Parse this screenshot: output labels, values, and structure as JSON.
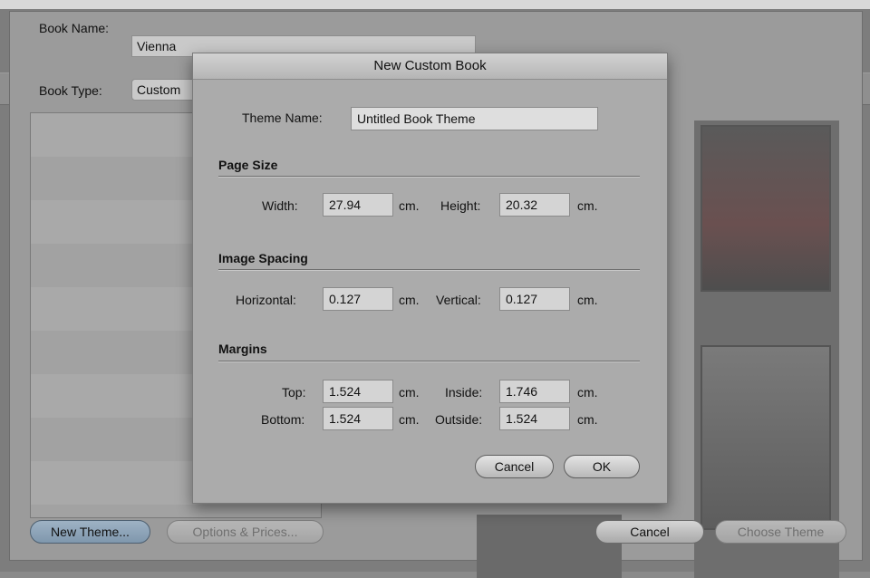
{
  "sheet": {
    "book_name_label": "Book Name:",
    "book_name_value": "Vienna",
    "book_type_label": "Book Type:",
    "book_type_value": "Custom",
    "buttons": {
      "new_theme": "New Theme...",
      "options_prices": "Options & Prices...",
      "cancel": "Cancel",
      "choose_theme": "Choose Theme"
    }
  },
  "dialog": {
    "title": "New Custom Book",
    "theme_name_label": "Theme Name:",
    "theme_name_value": "Untitled Book Theme",
    "page_size": {
      "heading": "Page Size",
      "width_label": "Width:",
      "width_value": "27.94",
      "height_label": "Height:",
      "height_value": "20.32",
      "unit": "cm."
    },
    "image_spacing": {
      "heading": "Image Spacing",
      "horizontal_label": "Horizontal:",
      "horizontal_value": "0.127",
      "vertical_label": "Vertical:",
      "vertical_value": "0.127",
      "unit": "cm."
    },
    "margins": {
      "heading": "Margins",
      "top_label": "Top:",
      "top_value": "1.524",
      "inside_label": "Inside:",
      "inside_value": "1.746",
      "bottom_label": "Bottom:",
      "bottom_value": "1.524",
      "outside_label": "Outside:",
      "outside_value": "1.524",
      "unit": "cm."
    },
    "buttons": {
      "cancel": "Cancel",
      "ok": "OK"
    }
  }
}
